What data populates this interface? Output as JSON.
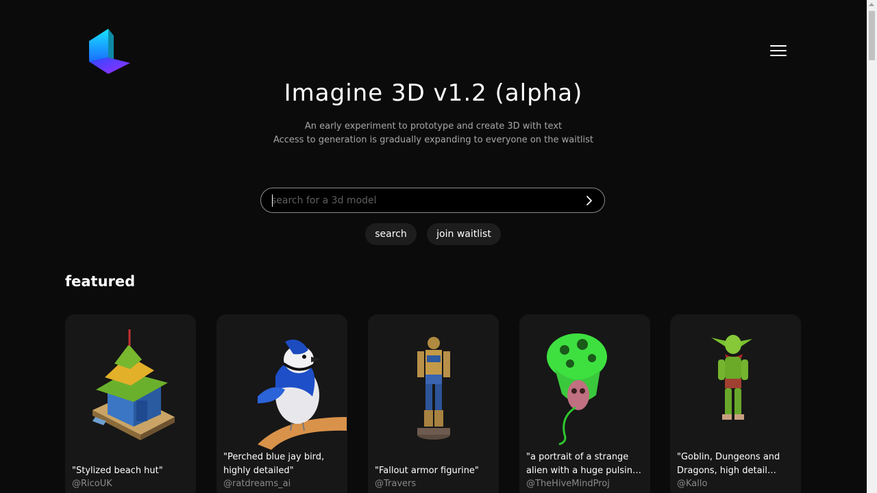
{
  "app": {
    "title": "Imagine 3D v1.2 (alpha)",
    "logo_icon": "luma-logo-icon",
    "menu_icon": "hamburger-menu-icon"
  },
  "hero": {
    "subtitle_line1": "An early experiment to prototype and create 3D with text",
    "subtitle_line2": "Access to generation is gradually expanding to everyone on the waitlist"
  },
  "search": {
    "placeholder": "search for a 3d model",
    "value": "",
    "submit_icon": "chevron-right-icon"
  },
  "buttons": {
    "search_label": "search",
    "waitlist_label": "join waitlist"
  },
  "featured": {
    "heading": "featured",
    "cards": [
      {
        "caption": "\"Stylized beach hut\"",
        "author": "@RicoUK"
      },
      {
        "caption": "\"Perched blue jay bird, highly detailed\"",
        "author": "@ratdreams_ai"
      },
      {
        "caption": "\"Fallout armor figurine\"",
        "author": "@Travers"
      },
      {
        "caption": "\"a portrait of a strange alien with a huge pulsing wet…",
        "author": "@TheHiveMindProj"
      },
      {
        "caption": "\"Goblin, Dungeons and Dragons, high detail mesh…",
        "author": "@Kallo"
      }
    ]
  },
  "colors": {
    "background": "#0b0b0b",
    "card": "#171717",
    "pill": "#1d1d1d",
    "muted_text": "#a7a7a7"
  }
}
